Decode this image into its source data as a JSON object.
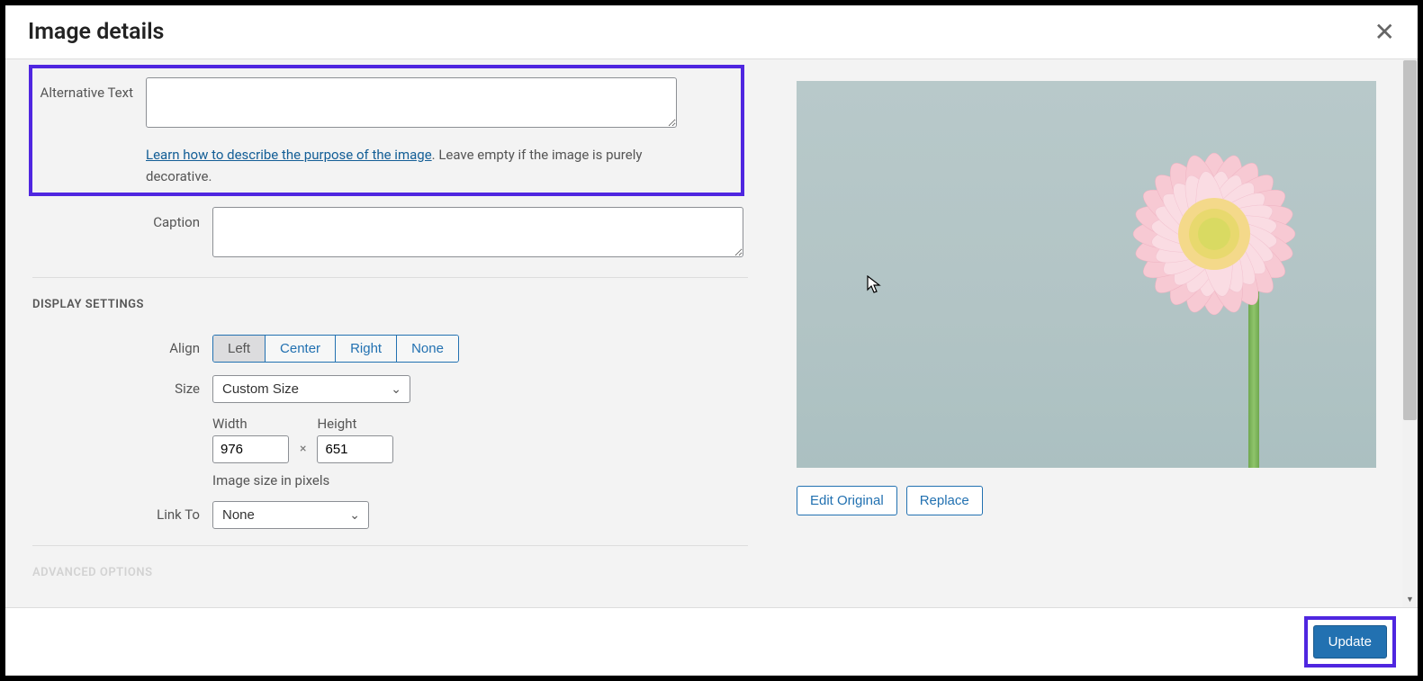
{
  "header": {
    "title": "Image details",
    "close": "✕"
  },
  "fields": {
    "alt_label": "Alternative Text",
    "alt_value": "",
    "alt_help_link": "Learn how to describe the purpose of the image",
    "alt_help_tail": ". Leave empty if the image is purely decorative.",
    "caption_label": "Caption",
    "caption_value": ""
  },
  "display": {
    "heading": "DISPLAY SETTINGS",
    "align_label": "Align",
    "align_options": {
      "left": "Left",
      "center": "Center",
      "right": "Right",
      "none": "None"
    },
    "size_label": "Size",
    "size_value": "Custom Size",
    "width_label": "Width",
    "width_value": "976",
    "height_label": "Height",
    "height_value": "651",
    "dim_sep": "×",
    "pixels_note": "Image size in pixels",
    "linkto_label": "Link To",
    "linkto_value": "None"
  },
  "advanced_heading": "ADVANCED OPTIONS",
  "preview": {
    "edit_original": "Edit Original",
    "replace": "Replace"
  },
  "footer": {
    "update": "Update"
  }
}
